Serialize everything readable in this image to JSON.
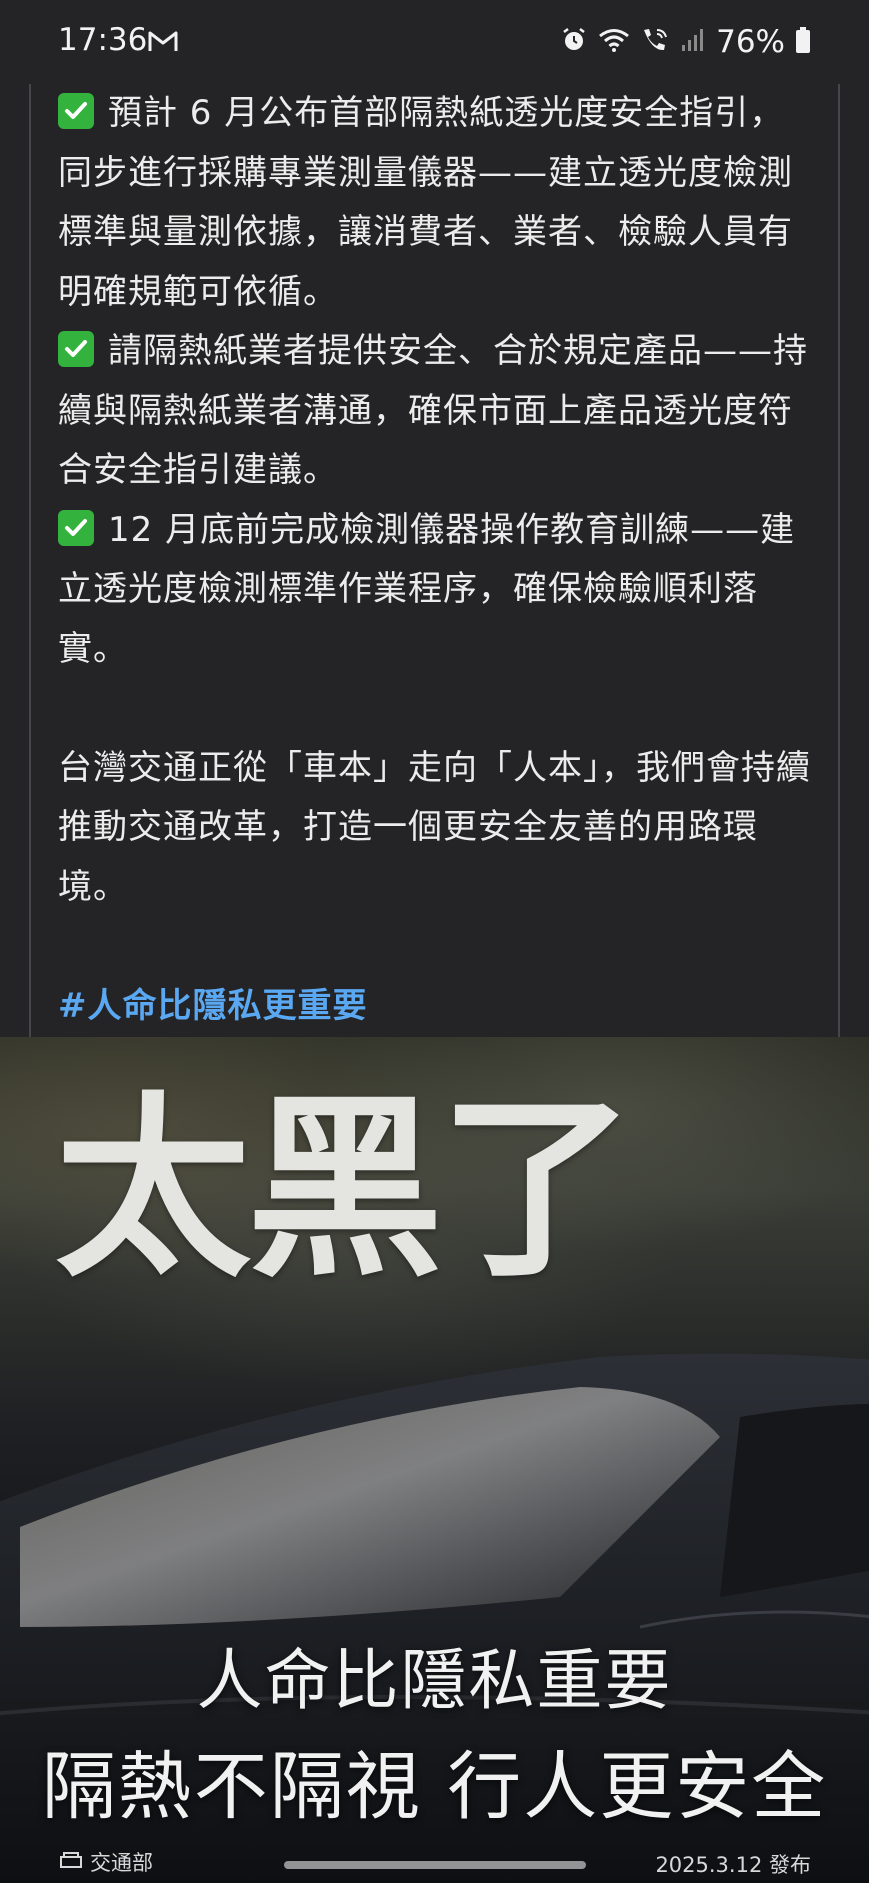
{
  "status_bar": {
    "time": "17:36",
    "battery": "76%",
    "icons": [
      "gmail-icon",
      "alarm-icon",
      "wifi-icon",
      "wifi-calling-icon",
      "signal-icon",
      "battery-icon"
    ]
  },
  "post": {
    "paragraphs": [
      {
        "check": true,
        "text": "預計 6 月公布首部隔熱紙透光度安全指引，同步進行採購專業測量儀器——建立透光度檢測標準與量測依據，讓消費者、業者、檢驗人員有明確規範可依循。"
      },
      {
        "check": true,
        "text": "請隔熱紙業者提供安全、合於規定產品——持續與隔熱紙業者溝通，確保市面上產品透光度符合安全指引建議。"
      },
      {
        "check": true,
        "text": "12 月底前完成檢測儀器操作教育訓練——建立透光度檢測標準作業程序，確保檢驗順利落實。"
      }
    ],
    "closing": "台灣交通正從「車本」走向「人本」，我們會持續推動交通改革，打造一個更安全友善的用路環境。",
    "hashtag": "#人命比隱私更重要"
  },
  "banner": {
    "title": "太黑了",
    "slogan_line1": "人命比隱私重要",
    "slogan_line2": "隔熱不隔視  行人更安全",
    "publisher": "交通部",
    "date": "2025.3.12 發布"
  },
  "colors": {
    "background": "#242426",
    "text": "#ececec",
    "hashtag": "#5aa7f2",
    "check": "#33b33d"
  }
}
